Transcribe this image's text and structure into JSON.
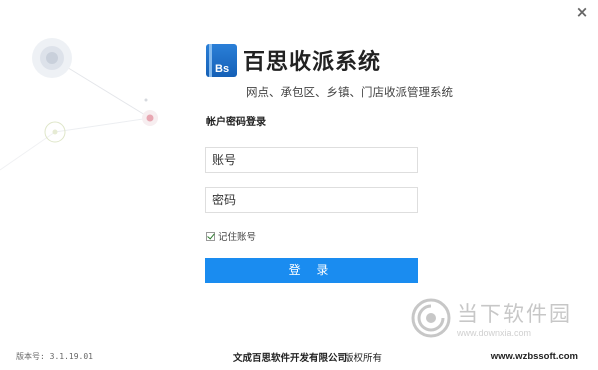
{
  "window": {
    "close_icon": "×"
  },
  "logo": {
    "text": "Bs"
  },
  "header": {
    "title": "百思收派系统",
    "subtitle": "网点、承包区、乡镇、门店收派管理系统"
  },
  "login": {
    "section_title": "帐户密码登录",
    "account_placeholder": "账号",
    "password_placeholder": "密码",
    "remember_label": "记住账号",
    "remember_checked": true,
    "submit_label": "登 录"
  },
  "footer": {
    "version": "版本号: 3.1.19.01",
    "company": "文成百思软件开发有限公司",
    "rights": "版权所有",
    "website": "www.wzbssoft.com"
  },
  "watermark": {
    "cn": "当下软件园",
    "en": "www.downxia.com"
  },
  "colors": {
    "accent": "#1a8cf0",
    "logo": "#1a6fcb"
  }
}
